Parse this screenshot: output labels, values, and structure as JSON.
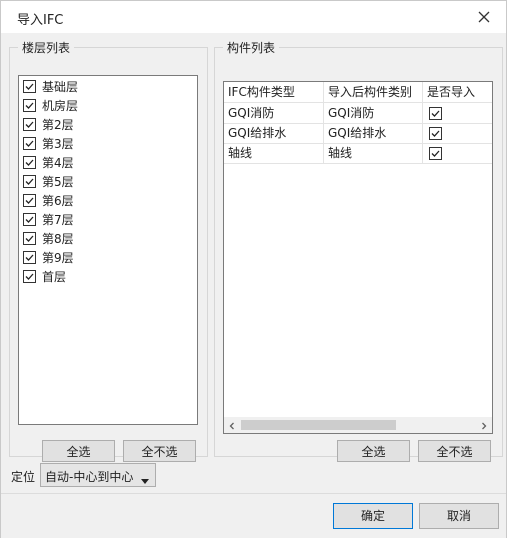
{
  "window": {
    "title": "导入IFC"
  },
  "floors": {
    "legend": "楼层列表",
    "items": [
      {
        "label": "基础层",
        "checked": true
      },
      {
        "label": "机房层",
        "checked": true
      },
      {
        "label": "第2层",
        "checked": true
      },
      {
        "label": "第3层",
        "checked": true
      },
      {
        "label": "第4层",
        "checked": true
      },
      {
        "label": "第5层",
        "checked": true
      },
      {
        "label": "第6层",
        "checked": true
      },
      {
        "label": "第7层",
        "checked": true
      },
      {
        "label": "第8层",
        "checked": true
      },
      {
        "label": "第9层",
        "checked": true
      },
      {
        "label": "首层",
        "checked": true
      }
    ],
    "select_all": "全选",
    "select_none": "全不选"
  },
  "components": {
    "legend": "构件列表",
    "columns": [
      "IFC构件类型",
      "导入后构件类别",
      "是否导入"
    ],
    "rows": [
      {
        "ifc": "GQI消防",
        "category": "GQI消防",
        "import": true
      },
      {
        "ifc": "GQI给排水",
        "category": "GQI给排水",
        "import": true
      },
      {
        "ifc": "轴线",
        "category": "轴线",
        "import": true
      }
    ],
    "select_all": "全选",
    "select_none": "全不选"
  },
  "position": {
    "label": "定位",
    "value": "自动-中心到中心"
  },
  "footer": {
    "ok": "确定",
    "cancel": "取消"
  },
  "icons": {
    "close": "close-icon",
    "check": "checkmark-icon",
    "dropdown": "triangle-down-icon"
  }
}
